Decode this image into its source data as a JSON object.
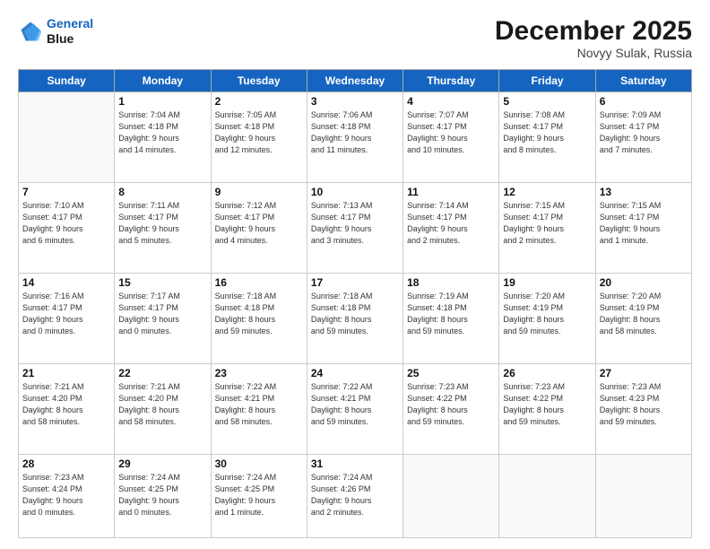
{
  "header": {
    "logo_line1": "General",
    "logo_line2": "Blue",
    "month": "December 2025",
    "location": "Novyy Sulak, Russia"
  },
  "days_of_week": [
    "Sunday",
    "Monday",
    "Tuesday",
    "Wednesday",
    "Thursday",
    "Friday",
    "Saturday"
  ],
  "weeks": [
    [
      {
        "day": "",
        "info": ""
      },
      {
        "day": "1",
        "info": "Sunrise: 7:04 AM\nSunset: 4:18 PM\nDaylight: 9 hours\nand 14 minutes."
      },
      {
        "day": "2",
        "info": "Sunrise: 7:05 AM\nSunset: 4:18 PM\nDaylight: 9 hours\nand 12 minutes."
      },
      {
        "day": "3",
        "info": "Sunrise: 7:06 AM\nSunset: 4:18 PM\nDaylight: 9 hours\nand 11 minutes."
      },
      {
        "day": "4",
        "info": "Sunrise: 7:07 AM\nSunset: 4:17 PM\nDaylight: 9 hours\nand 10 minutes."
      },
      {
        "day": "5",
        "info": "Sunrise: 7:08 AM\nSunset: 4:17 PM\nDaylight: 9 hours\nand 8 minutes."
      },
      {
        "day": "6",
        "info": "Sunrise: 7:09 AM\nSunset: 4:17 PM\nDaylight: 9 hours\nand 7 minutes."
      }
    ],
    [
      {
        "day": "7",
        "info": "Sunrise: 7:10 AM\nSunset: 4:17 PM\nDaylight: 9 hours\nand 6 minutes."
      },
      {
        "day": "8",
        "info": "Sunrise: 7:11 AM\nSunset: 4:17 PM\nDaylight: 9 hours\nand 5 minutes."
      },
      {
        "day": "9",
        "info": "Sunrise: 7:12 AM\nSunset: 4:17 PM\nDaylight: 9 hours\nand 4 minutes."
      },
      {
        "day": "10",
        "info": "Sunrise: 7:13 AM\nSunset: 4:17 PM\nDaylight: 9 hours\nand 3 minutes."
      },
      {
        "day": "11",
        "info": "Sunrise: 7:14 AM\nSunset: 4:17 PM\nDaylight: 9 hours\nand 2 minutes."
      },
      {
        "day": "12",
        "info": "Sunrise: 7:15 AM\nSunset: 4:17 PM\nDaylight: 9 hours\nand 2 minutes."
      },
      {
        "day": "13",
        "info": "Sunrise: 7:15 AM\nSunset: 4:17 PM\nDaylight: 9 hours\nand 1 minute."
      }
    ],
    [
      {
        "day": "14",
        "info": "Sunrise: 7:16 AM\nSunset: 4:17 PM\nDaylight: 9 hours\nand 0 minutes."
      },
      {
        "day": "15",
        "info": "Sunrise: 7:17 AM\nSunset: 4:17 PM\nDaylight: 9 hours\nand 0 minutes."
      },
      {
        "day": "16",
        "info": "Sunrise: 7:18 AM\nSunset: 4:18 PM\nDaylight: 8 hours\nand 59 minutes."
      },
      {
        "day": "17",
        "info": "Sunrise: 7:18 AM\nSunset: 4:18 PM\nDaylight: 8 hours\nand 59 minutes."
      },
      {
        "day": "18",
        "info": "Sunrise: 7:19 AM\nSunset: 4:18 PM\nDaylight: 8 hours\nand 59 minutes."
      },
      {
        "day": "19",
        "info": "Sunrise: 7:20 AM\nSunset: 4:19 PM\nDaylight: 8 hours\nand 59 minutes."
      },
      {
        "day": "20",
        "info": "Sunrise: 7:20 AM\nSunset: 4:19 PM\nDaylight: 8 hours\nand 58 minutes."
      }
    ],
    [
      {
        "day": "21",
        "info": "Sunrise: 7:21 AM\nSunset: 4:20 PM\nDaylight: 8 hours\nand 58 minutes."
      },
      {
        "day": "22",
        "info": "Sunrise: 7:21 AM\nSunset: 4:20 PM\nDaylight: 8 hours\nand 58 minutes."
      },
      {
        "day": "23",
        "info": "Sunrise: 7:22 AM\nSunset: 4:21 PM\nDaylight: 8 hours\nand 58 minutes."
      },
      {
        "day": "24",
        "info": "Sunrise: 7:22 AM\nSunset: 4:21 PM\nDaylight: 8 hours\nand 59 minutes."
      },
      {
        "day": "25",
        "info": "Sunrise: 7:23 AM\nSunset: 4:22 PM\nDaylight: 8 hours\nand 59 minutes."
      },
      {
        "day": "26",
        "info": "Sunrise: 7:23 AM\nSunset: 4:22 PM\nDaylight: 8 hours\nand 59 minutes."
      },
      {
        "day": "27",
        "info": "Sunrise: 7:23 AM\nSunset: 4:23 PM\nDaylight: 8 hours\nand 59 minutes."
      }
    ],
    [
      {
        "day": "28",
        "info": "Sunrise: 7:23 AM\nSunset: 4:24 PM\nDaylight: 9 hours\nand 0 minutes."
      },
      {
        "day": "29",
        "info": "Sunrise: 7:24 AM\nSunset: 4:25 PM\nDaylight: 9 hours\nand 0 minutes."
      },
      {
        "day": "30",
        "info": "Sunrise: 7:24 AM\nSunset: 4:25 PM\nDaylight: 9 hours\nand 1 minute."
      },
      {
        "day": "31",
        "info": "Sunrise: 7:24 AM\nSunset: 4:26 PM\nDaylight: 9 hours\nand 2 minutes."
      },
      {
        "day": "",
        "info": ""
      },
      {
        "day": "",
        "info": ""
      },
      {
        "day": "",
        "info": ""
      }
    ]
  ]
}
